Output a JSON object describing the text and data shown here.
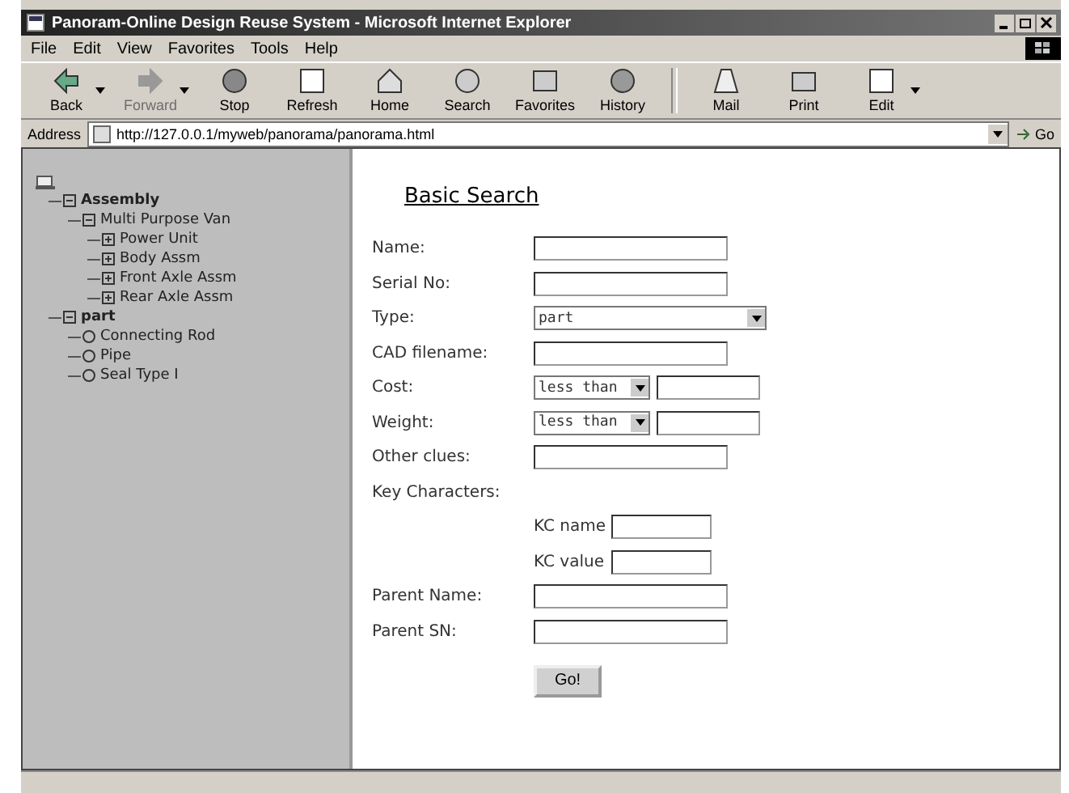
{
  "window": {
    "title": "Panoram-Online Design Reuse System - Microsoft Internet Explorer"
  },
  "menu": [
    "File",
    "Edit",
    "View",
    "Favorites",
    "Tools",
    "Help"
  ],
  "toolbar": [
    {
      "label": "Back",
      "kind": "back",
      "disabled": false,
      "dropdown": true
    },
    {
      "label": "Forward",
      "kind": "forward",
      "disabled": true,
      "dropdown": true
    },
    {
      "label": "Stop",
      "kind": "stop",
      "disabled": false,
      "dropdown": false
    },
    {
      "label": "Refresh",
      "kind": "refresh",
      "disabled": false,
      "dropdown": false
    },
    {
      "label": "Home",
      "kind": "home",
      "disabled": false,
      "dropdown": false
    },
    {
      "label": "Search",
      "kind": "search",
      "disabled": false,
      "dropdown": false
    },
    {
      "label": "Favorites",
      "kind": "favorites",
      "disabled": false,
      "dropdown": false
    },
    {
      "label": "History",
      "kind": "history",
      "disabled": false,
      "dropdown": false
    },
    {
      "label": "Mail",
      "kind": "mail",
      "disabled": false,
      "dropdown": false
    },
    {
      "label": "Print",
      "kind": "print",
      "disabled": false,
      "dropdown": false
    },
    {
      "label": "Edit",
      "kind": "edit",
      "disabled": false,
      "dropdown": true
    }
  ],
  "address": {
    "label": "Address",
    "value": "http://127.0.0.1/myweb/panorama/panorama.html",
    "go": "Go"
  },
  "tree": [
    {
      "label": "Assembly",
      "expanded": true,
      "children": [
        {
          "label": "Multi Purpose Van",
          "expanded": true,
          "children": [
            {
              "label": "Power Unit",
              "expanded": false
            },
            {
              "label": "Body Assm",
              "expanded": false
            },
            {
              "label": "Front Axle Assm",
              "expanded": false
            },
            {
              "label": "Rear Axle Assm",
              "expanded": false
            }
          ]
        }
      ]
    },
    {
      "label": "part",
      "expanded": true,
      "children": [
        {
          "label": "Connecting Rod",
          "kind": "leaf"
        },
        {
          "label": "Pipe",
          "kind": "leaf"
        },
        {
          "label": "Seal Type I",
          "kind": "leaf"
        }
      ]
    }
  ],
  "form": {
    "heading": "Basic Search",
    "fields": [
      {
        "label": "Name:",
        "kind": "text"
      },
      {
        "label": "Serial No:",
        "kind": "text"
      },
      {
        "label": "Type:",
        "kind": "select",
        "value": "part"
      },
      {
        "label": "CAD filename:",
        "kind": "text"
      },
      {
        "label": "Cost:",
        "kind": "compare",
        "value": "less than"
      },
      {
        "label": "Weight:",
        "kind": "compare",
        "value": "less than"
      },
      {
        "label": "Other clues:",
        "kind": "text"
      },
      {
        "label": "Key Characters:",
        "kind": "header"
      },
      {
        "label": "KC name",
        "kind": "sub"
      },
      {
        "label": "KC value",
        "kind": "sub"
      },
      {
        "label": "Parent Name:",
        "kind": "text"
      },
      {
        "label": "Parent SN:",
        "kind": "text"
      }
    ],
    "button": "Go!"
  }
}
